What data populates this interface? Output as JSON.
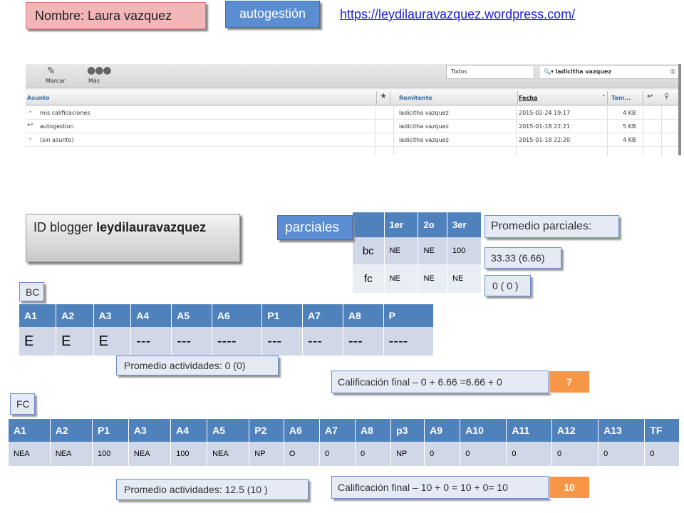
{
  "header": {
    "name": "Nombre: Laura vazquez",
    "button": "autogestión",
    "link": "https://leydilauravazquez.wordpress.com/"
  },
  "mail": {
    "toolbar": {
      "mark": "Marcar",
      "more": "Más",
      "filter": "Todos",
      "search": "ladicitha vazquez"
    },
    "columns": {
      "subject": "Asunto",
      "sender": "Remitente",
      "date": "Fecha",
      "size": "Tam..."
    },
    "rows": [
      {
        "subject": "mis calificaciones",
        "sender": "ladicitha vazquez",
        "date": "2015-02-24 19:17",
        "size": "4 KB"
      },
      {
        "subject": "autogestion",
        "sender": "ladicitha vazquez",
        "date": "2015-01-18 22:21",
        "size": "5 KB"
      },
      {
        "subject": "(sin asunto)",
        "sender": "ladicitha vazquez",
        "date": "2015-01-18 22:20",
        "size": "4 KB"
      }
    ]
  },
  "blogger": {
    "prefix": "ID blogger ",
    "user": "leydilauravazquez"
  },
  "parciales": {
    "label": "parciales",
    "headers": [
      "",
      "1er",
      "2o",
      "3er"
    ],
    "rows": [
      [
        "bc",
        "NE",
        "NE",
        "100"
      ],
      [
        "fc",
        "NE",
        "NE",
        "NE"
      ]
    ],
    "promedio_label": "Promedio parciales:",
    "promedio_bc": "33.33 (6.66)",
    "promedio_fc": "0 ( 0 )"
  },
  "bc": {
    "label": "BC",
    "headers": [
      "A1",
      "A2",
      "A3",
      "A4",
      "A5",
      "A6",
      "P1",
      "A7",
      "A8",
      "P"
    ],
    "values": [
      "E",
      "E",
      "E",
      "---",
      "---",
      "----",
      "---",
      "---",
      "---",
      "----"
    ],
    "promedio": "Promedio actividades: 0 (0)",
    "final_label": "Calificación final – 0 + 6.66 =6.66 + 0",
    "final_value": "7"
  },
  "fc": {
    "label": "FC",
    "headers": [
      "A1",
      "A2",
      "P1",
      "A3",
      "A4",
      "A5",
      "P2",
      "A6",
      "A7",
      "A8",
      "p3",
      "A9",
      "A10",
      "A11",
      "A12",
      "A13",
      "TF"
    ],
    "values": [
      "NEA",
      "NEA",
      "100",
      "NEA",
      "100",
      "NEA",
      "NP",
      "O",
      "0",
      "0",
      "NP",
      "0",
      "0",
      "0",
      "0",
      "0",
      "0"
    ],
    "promedio": "Promedio actividades: 12.5  (10 )",
    "final_label": "Calificación final – 10 + 0 = 10 + 0= 10",
    "final_value": "10"
  },
  "colors": {
    "accent": "#4f81bd",
    "orange": "#f79646",
    "pink": "#f2b6b6"
  }
}
